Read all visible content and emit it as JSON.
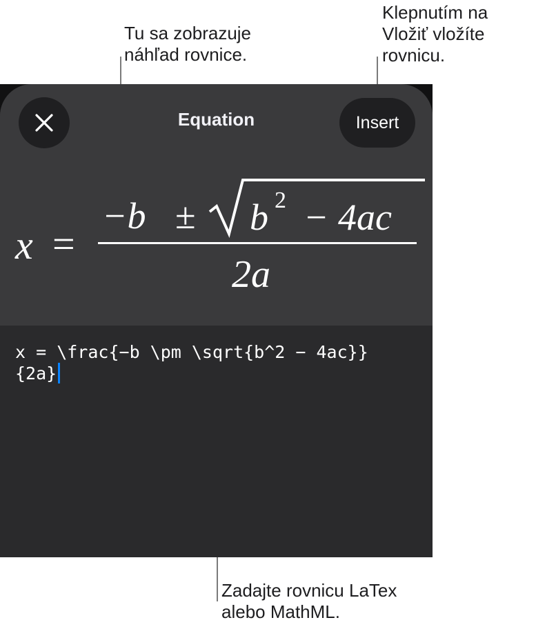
{
  "callouts": {
    "preview": {
      "line1": "Tu sa zobrazuje",
      "line2": "náhľad rovnice."
    },
    "insert": {
      "line1": "Klepnutím na",
      "line2": "Vložiť vložíte",
      "line3": "rovnicu."
    },
    "editor": {
      "line1": "Zadajte rovnicu LaTex",
      "line2": "alebo MathML."
    }
  },
  "dialog": {
    "title": "Equation",
    "close_icon": "close-icon",
    "insert_label": "Insert"
  },
  "preview": {
    "lhs_var": "x",
    "equals": "=",
    "numerator": {
      "neg_b": "−b",
      "pm": "±",
      "radicand_b": "b",
      "exponent": "2",
      "rest": "− 4ac"
    },
    "denominator": "2a"
  },
  "editor": {
    "line1": "x = \\frac{−b \\pm \\sqrt{b^2 − 4ac}}",
    "line2": "{2a}",
    "caret_color": "#0a84ff"
  }
}
